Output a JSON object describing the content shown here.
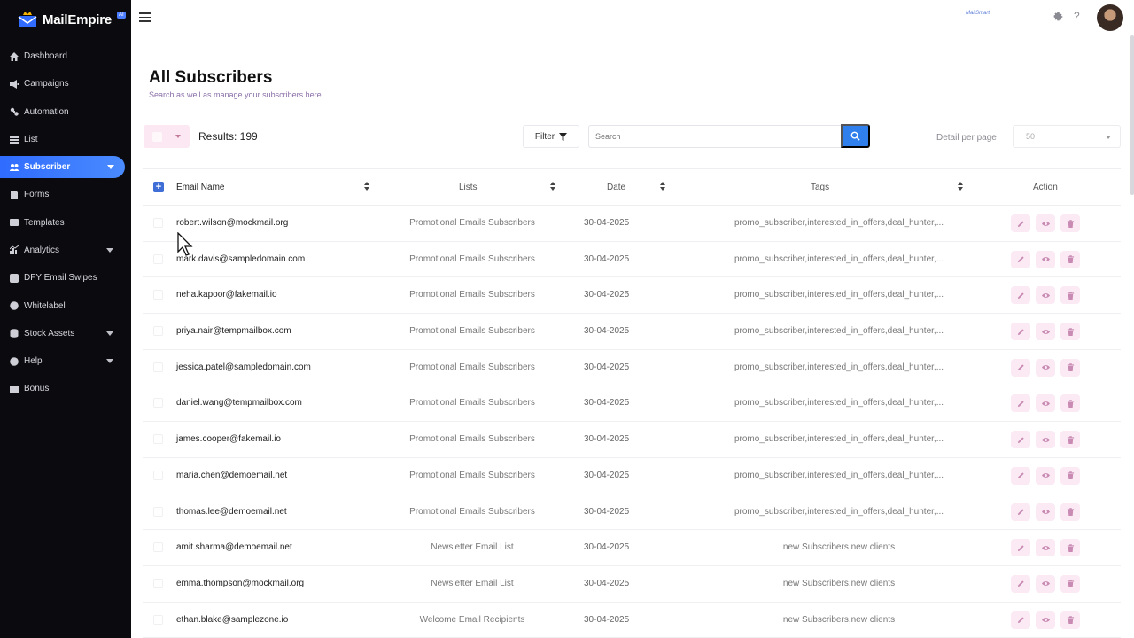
{
  "brand": {
    "name": "MailEmpire",
    "badge": "AI"
  },
  "sidebar": {
    "items": [
      {
        "label": "Dashboard",
        "icon": "home-icon",
        "caret": false,
        "active": false
      },
      {
        "label": "Campaigns",
        "icon": "megaphone-icon",
        "caret": false,
        "active": false
      },
      {
        "label": "Automation",
        "icon": "automation-icon",
        "caret": false,
        "active": false
      },
      {
        "label": "List",
        "icon": "list-icon",
        "caret": false,
        "active": false
      },
      {
        "label": "Subscriber",
        "icon": "users-icon",
        "caret": true,
        "active": true
      },
      {
        "label": "Forms",
        "icon": "form-icon",
        "caret": false,
        "active": false
      },
      {
        "label": "Templates",
        "icon": "template-icon",
        "caret": false,
        "active": false
      },
      {
        "label": "Analytics",
        "icon": "chart-icon",
        "caret": true,
        "active": false
      },
      {
        "label": "DFY Email Swipes",
        "icon": "swipe-icon",
        "caret": false,
        "active": false
      },
      {
        "label": "Whitelabel",
        "icon": "globe-icon",
        "caret": false,
        "active": false
      },
      {
        "label": "Stock Assets",
        "icon": "database-icon",
        "caret": true,
        "active": false
      },
      {
        "label": "Help",
        "icon": "help-icon",
        "caret": true,
        "active": false
      },
      {
        "label": "Bonus",
        "icon": "gift-icon",
        "caret": false,
        "active": false
      }
    ]
  },
  "topbar": {
    "logo_text": "MailSmart"
  },
  "page": {
    "title": "All Subscribers",
    "subtitle": "Search as well as manage your subscribers here"
  },
  "toolbar": {
    "results_label": "Results: 199",
    "filter_label": "Filter",
    "search_placeholder": "Search",
    "per_page_label": "Detail per page",
    "per_page_value": "50"
  },
  "table": {
    "columns": [
      "Email Name",
      "Lists",
      "Date",
      "Tags",
      "Action"
    ],
    "rows": [
      {
        "email": "robert.wilson@mockmail.org",
        "list": "Promotional Emails Subscribers",
        "date": "30-04-2025",
        "tags": "promo_subscriber,interested_in_offers,deal_hunter,..."
      },
      {
        "email": "mark.davis@sampledomain.com",
        "list": "Promotional Emails Subscribers",
        "date": "30-04-2025",
        "tags": "promo_subscriber,interested_in_offers,deal_hunter,..."
      },
      {
        "email": "neha.kapoor@fakemail.io",
        "list": "Promotional Emails Subscribers",
        "date": "30-04-2025",
        "tags": "promo_subscriber,interested_in_offers,deal_hunter,..."
      },
      {
        "email": "priya.nair@tempmailbox.com",
        "list": "Promotional Emails Subscribers",
        "date": "30-04-2025",
        "tags": "promo_subscriber,interested_in_offers,deal_hunter,..."
      },
      {
        "email": "jessica.patel@sampledomain.com",
        "list": "Promotional Emails Subscribers",
        "date": "30-04-2025",
        "tags": "promo_subscriber,interested_in_offers,deal_hunter,..."
      },
      {
        "email": "daniel.wang@tempmailbox.com",
        "list": "Promotional Emails Subscribers",
        "date": "30-04-2025",
        "tags": "promo_subscriber,interested_in_offers,deal_hunter,..."
      },
      {
        "email": "james.cooper@fakemail.io",
        "list": "Promotional Emails Subscribers",
        "date": "30-04-2025",
        "tags": "promo_subscriber,interested_in_offers,deal_hunter,..."
      },
      {
        "email": "maria.chen@demoemail.net",
        "list": "Promotional Emails Subscribers",
        "date": "30-04-2025",
        "tags": "promo_subscriber,interested_in_offers,deal_hunter,..."
      },
      {
        "email": "thomas.lee@demoemail.net",
        "list": "Promotional Emails Subscribers",
        "date": "30-04-2025",
        "tags": "promo_subscriber,interested_in_offers,deal_hunter,..."
      },
      {
        "email": "amit.sharma@demoemail.net",
        "list": "Newsletter Email List",
        "date": "30-04-2025",
        "tags": "new Subscribers,new clients"
      },
      {
        "email": "emma.thompson@mockmail.org",
        "list": "Newsletter Email List",
        "date": "30-04-2025",
        "tags": "new Subscribers,new clients"
      },
      {
        "email": "ethan.blake@samplezone.io",
        "list": "Welcome Email Recipients",
        "date": "30-04-2025",
        "tags": "new Subscribers,new clients"
      }
    ]
  },
  "colors": {
    "accent": "#2f80ed",
    "sidebar_bg": "#0b0b0f",
    "action_bg": "#fbeaf4",
    "action_icon": "#c98bb3"
  }
}
